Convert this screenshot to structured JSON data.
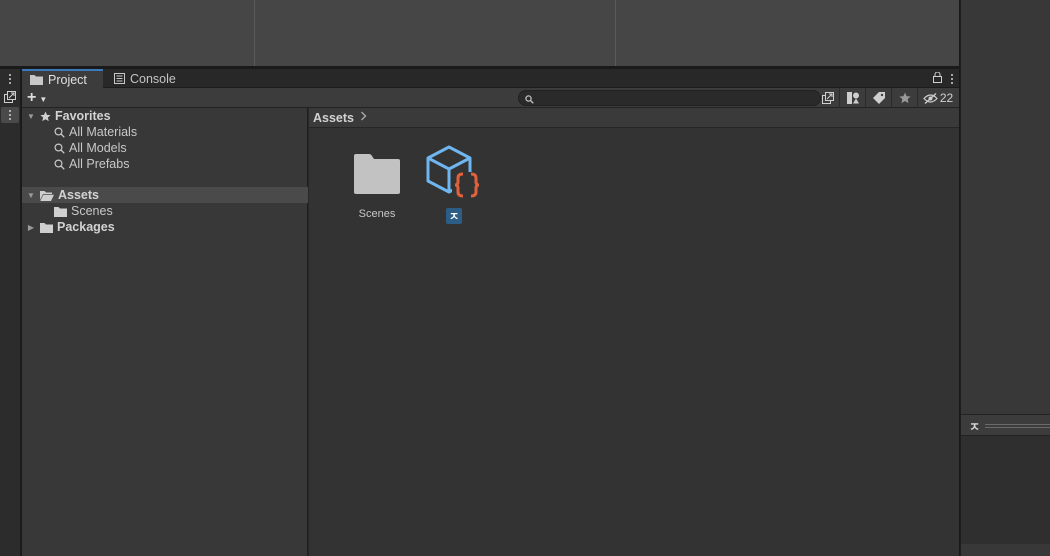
{
  "tabs": [
    {
      "label": "Project",
      "icon": "folder-icon",
      "active": true
    },
    {
      "label": "Console",
      "icon": "console-icon",
      "active": false
    }
  ],
  "toolbar": {
    "create_label": "+",
    "search_placeholder": "",
    "search_value": "",
    "hidden_count": "22"
  },
  "tree": {
    "favorites": {
      "label": "Favorites",
      "items": [
        "All Materials",
        "All Models",
        "All Prefabs"
      ]
    },
    "assets": {
      "label": "Assets",
      "children": [
        "Scenes"
      ]
    },
    "packages": {
      "label": "Packages"
    }
  },
  "breadcrumb": {
    "label": "Assets"
  },
  "assets_grid": [
    {
      "label": "Scenes",
      "icon": "folder-icon"
    },
    {
      "label": "ㅈ",
      "icon": "script-asset-icon",
      "renaming": true
    }
  ],
  "right_panel": {
    "glyph": "ㅈ"
  },
  "colors": {
    "tab_accent": "#3a79bb",
    "asset_cube": "#6fb6f0",
    "asset_braces": "#e0623c",
    "rename_highlight": "#2c5d87"
  }
}
